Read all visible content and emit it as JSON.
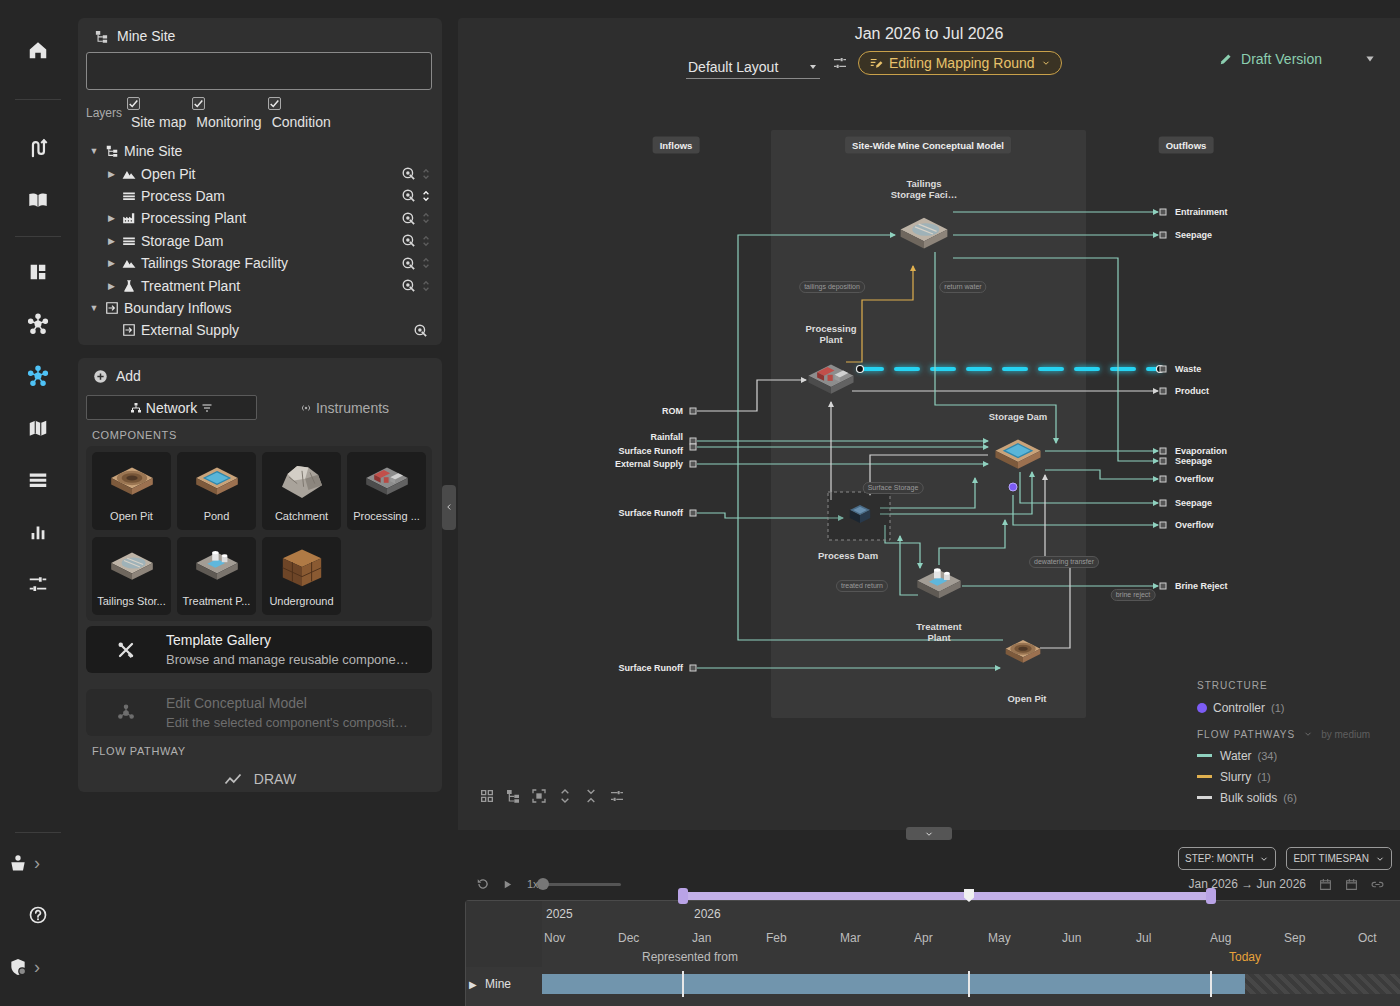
{
  "rail": {
    "top": [
      {
        "selected": false
      },
      {
        "selected": false
      },
      {
        "selected": false
      },
      {
        "selected": false
      },
      {
        "selected": false
      },
      {
        "selected": true
      },
      {
        "selected": false
      },
      {
        "selected": false
      },
      {
        "selected": false
      },
      {
        "selected": false
      }
    ],
    "bottom": [
      {
        "has_menu": true,
        "arrow": "›"
      },
      {
        "has_menu": false
      },
      {
        "has_menu": true,
        "arrow": "›"
      }
    ]
  },
  "tree_panel": {
    "title": "Mine Site",
    "search": {
      "value": ""
    },
    "layers": {
      "label": "Layers",
      "items": [
        {
          "label": "Site map",
          "checked": true
        },
        {
          "label": "Monitoring",
          "checked": true
        },
        {
          "label": "Condition",
          "checked": true
        }
      ]
    },
    "tree": [
      {
        "label": "Mine Site",
        "kind": "site",
        "level": 0,
        "toggle": "▼",
        "expanded": true,
        "target": false,
        "reorder": false
      },
      {
        "label": "Open Pit",
        "kind": "pit",
        "level": 1,
        "toggle": "▶",
        "expanded": false,
        "target": true,
        "reorder": true,
        "reorder_active": false
      },
      {
        "label": "Process Dam",
        "kind": "dam",
        "level": 1,
        "target": true,
        "reorder": true,
        "reorder_active": true
      },
      {
        "label": "Processing Plant",
        "kind": "plant",
        "level": 1,
        "toggle": "▶",
        "expanded": false,
        "target": true,
        "reorder": true,
        "reorder_active": false
      },
      {
        "label": "Storage Dam",
        "kind": "dam",
        "level": 1,
        "toggle": "▶",
        "expanded": false,
        "target": true,
        "reorder": true,
        "reorder_active": false
      },
      {
        "label": "Tailings Storage Facility",
        "kind": "pit",
        "level": 1,
        "toggle": "▶",
        "expanded": false,
        "target": true,
        "reorder": true,
        "reorder_active": false
      },
      {
        "label": "Treatment Plant",
        "kind": "treatment",
        "level": 1,
        "toggle": "▶",
        "expanded": false,
        "target": true,
        "reorder": true,
        "reorder_active": false
      },
      {
        "label": "Boundary Inflows",
        "kind": "boundary",
        "level": 0,
        "toggle": "▼",
        "expanded": true,
        "target": false,
        "reorder": false
      },
      {
        "label": "External Supply",
        "kind": "boundary",
        "level": 1,
        "target": true,
        "reorder": false
      }
    ]
  },
  "add_panel": {
    "add_label": "Add",
    "tabs": [
      {
        "label": "Network",
        "selected": true
      },
      {
        "label": "Instruments",
        "selected": false
      }
    ],
    "components_title": "COMPONENTS",
    "components": [
      {
        "label": "Open Pit",
        "kind": "pit"
      },
      {
        "label": "Pond",
        "kind": "pond"
      },
      {
        "label": "Catchment",
        "kind": "catchment"
      },
      {
        "label": "Processing ...",
        "kind": "processing"
      },
      {
        "label": "Tailings Stor...",
        "kind": "tailings"
      },
      {
        "label": "Treatment P...",
        "kind": "treatment"
      },
      {
        "label": "Underground",
        "kind": "underground"
      }
    ],
    "cards": [
      {
        "title": "Template Gallery",
        "description": "Browse and manage reusable compone…",
        "disabled": false,
        "kind": "gallery"
      },
      {
        "title": "Edit Conceptual Model",
        "description": "Edit the selected component's composit…",
        "disabled": true,
        "kind": "model"
      }
    ],
    "flow_title": "FLOW PATHWAY",
    "draw": "DRAW"
  },
  "header": {
    "period": "Jan 2026 to Jul 2026",
    "layout": "Default Layout",
    "mode": "Editing Mapping Round",
    "version": "Draft Version"
  },
  "diagram": {
    "columns": [
      "Inflows",
      "Site-Wide Mine Conceptual Model",
      "Outflows"
    ],
    "nodes": [
      {
        "label": "Tailings Storage Faci…",
        "kind": "tailings",
        "selected": false
      },
      {
        "label": "Processing Plant",
        "kind": "processing",
        "selected": false
      },
      {
        "label": "Storage Dam",
        "kind": "pond",
        "selected": false
      },
      {
        "label": "Process Dam",
        "kind": "dam",
        "selected": true
      },
      {
        "label": "Treatment Plant",
        "kind": "treatment",
        "selected": false
      },
      {
        "label": "Open Pit",
        "kind": "pit",
        "selected": false
      }
    ],
    "inflows": [
      "ROM",
      "Rainfall",
      "Surface Runoff",
      "External Supply",
      "Surface Runoff",
      "Surface Runoff"
    ],
    "outflows": [
      "Entrainment",
      "Seepage",
      "Waste",
      "Product",
      "Evaporation",
      "Seepage",
      "Overflow",
      "Seepage",
      "Overflow",
      "Brine Reject"
    ],
    "edge_labels": [
      "tailings deposition",
      "return water",
      "Surface Storage",
      "dewatering transfer",
      "treated return",
      "brine reject"
    ],
    "edges": [
      {
        "medium": "Bulk solids",
        "selected": false
      },
      {
        "medium": "Water",
        "selected": false
      },
      {
        "medium": "Water",
        "selected": false
      },
      {
        "medium": "Water",
        "selected": false
      },
      {
        "medium": "Water",
        "selected": false
      },
      {
        "medium": "Water",
        "selected": false
      },
      {
        "medium": "Water",
        "selected": false
      },
      {
        "medium": "Water",
        "selected": false
      },
      {
        "medium": "Water",
        "selected": false
      },
      {
        "medium": "Slurry",
        "selected": false
      },
      {
        "medium": "Bulk solids",
        "selected": true
      },
      {
        "medium": "Bulk solids",
        "selected": false
      },
      {
        "medium": "Water",
        "selected": false
      },
      {
        "medium": "Water",
        "selected": false
      },
      {
        "medium": "Water",
        "selected": false
      },
      {
        "medium": "Water",
        "selected": false
      },
      {
        "medium": "Water",
        "selected": false
      },
      {
        "medium": "Water",
        "selected": false
      },
      {
        "medium": "Water",
        "selected": false
      },
      {
        "medium": "Water",
        "selected": false
      },
      {
        "medium": "Bulk solids",
        "selected": false
      },
      {
        "medium": "Water",
        "selected": false
      },
      {
        "medium": "Water",
        "selected": false
      },
      {
        "medium": "Water",
        "selected": false
      },
      {
        "medium": "Water",
        "selected": false
      },
      {
        "medium": "Bulk solids",
        "selected": false
      },
      {
        "medium": "Bulk solids",
        "selected": false
      }
    ]
  },
  "legend": {
    "structure_title": "STRUCTURE",
    "structure": [
      {
        "label": "Controller",
        "count": "(1)",
        "color": "#7c5cf5"
      }
    ],
    "flow_title": "FLOW PATHWAYS",
    "group_by": "by medium",
    "flows": [
      {
        "label": "Water",
        "count": "(34)",
        "color": "#8fd1bf"
      },
      {
        "label": "Slurry",
        "count": "(1)",
        "color": "#e0b04f"
      },
      {
        "label": "Bulk solids",
        "count": "(6)",
        "color": "#d6d6d6"
      }
    ]
  },
  "timeline": {
    "step": "STEP: MONTH",
    "edit": "EDIT TIMESPAN",
    "speed": "1x",
    "speed_level": 0.03,
    "playing": false,
    "range_text": "Jan 2026 → Jun 2026",
    "range": {
      "start": 0.232,
      "marker": 0.538,
      "end": 0.797
    },
    "markers": {
      "represented_from": "Represented from",
      "today": "Today"
    },
    "months": [
      {
        "label": "Nov",
        "year": "2025"
      },
      {
        "label": "Dec"
      },
      {
        "label": "Jan",
        "year": "2026",
        "represented_from": true
      },
      {
        "label": "Feb"
      },
      {
        "label": "Mar"
      },
      {
        "label": "Apr"
      },
      {
        "label": "May"
      },
      {
        "label": "Jun"
      },
      {
        "label": "Jul"
      },
      {
        "label": "Aug",
        "today": true
      },
      {
        "label": "Sep"
      },
      {
        "label": "Oct"
      }
    ],
    "rows": [
      {
        "label": "Mine",
        "toggle": "▶",
        "expanded": false
      }
    ]
  }
}
